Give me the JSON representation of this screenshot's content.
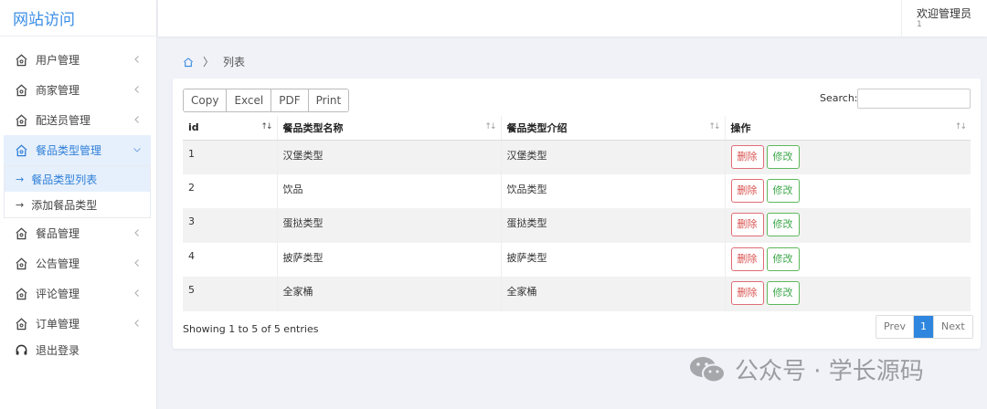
{
  "app": {
    "title": "网站访问"
  },
  "header": {
    "welcome": "欢迎管理员",
    "sub": "1"
  },
  "sidebar": {
    "items": [
      {
        "label": "用户管理",
        "icon": "home-icon"
      },
      {
        "label": "商家管理",
        "icon": "home-icon"
      },
      {
        "label": "配送员管理",
        "icon": "home-icon"
      },
      {
        "label": "餐品类型管理",
        "icon": "home-icon",
        "active": true
      },
      {
        "label": "餐品管理",
        "icon": "home-icon"
      },
      {
        "label": "公告管理",
        "icon": "home-icon"
      },
      {
        "label": "评论管理",
        "icon": "home-icon"
      },
      {
        "label": "订单管理",
        "icon": "home-icon"
      },
      {
        "label": "退出登录",
        "icon": "headset-icon"
      }
    ],
    "submenu": [
      {
        "label": "餐品类型列表",
        "active": true
      },
      {
        "label": "添加餐品类型"
      }
    ]
  },
  "breadcrumb": {
    "current": "列表"
  },
  "toolbar": {
    "copy": "Copy",
    "excel": "Excel",
    "pdf": "PDF",
    "print": "Print"
  },
  "search": {
    "label": "Search:",
    "value": ""
  },
  "table": {
    "columns": [
      "id",
      "餐品类型名称",
      "餐品类型介绍",
      "操作"
    ],
    "rows": [
      {
        "id": "1",
        "name": "汉堡类型",
        "desc": "汉堡类型"
      },
      {
        "id": "2",
        "name": "饮品",
        "desc": "饮品类型"
      },
      {
        "id": "3",
        "name": "蛋挞类型",
        "desc": "蛋挞类型"
      },
      {
        "id": "4",
        "name": "披萨类型",
        "desc": "披萨类型"
      },
      {
        "id": "5",
        "name": "全家桶",
        "desc": "全家桶"
      }
    ],
    "delete_label": "删除",
    "edit_label": "修改"
  },
  "footer": {
    "info": "Showing 1 to 5 of 5 entries"
  },
  "pager": {
    "prev": "Prev",
    "current": "1",
    "next": "Next"
  },
  "watermark": {
    "text": "公众号 · 学长源码"
  },
  "colors": {
    "accent": "#2f86de",
    "danger": "#d9534f",
    "success": "#3ea74a"
  }
}
